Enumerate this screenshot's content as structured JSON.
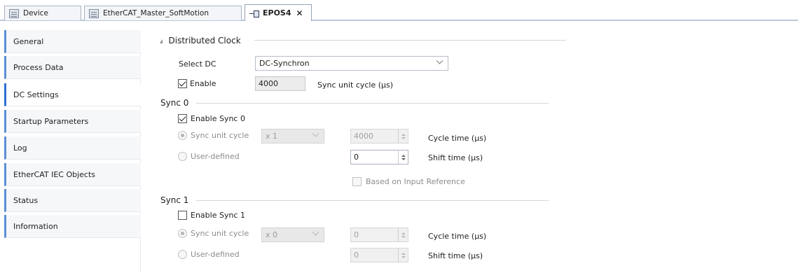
{
  "tabs": [
    {
      "label": "Device",
      "icon": "device-icon"
    },
    {
      "label": "EtherCAT_Master_SoftMotion",
      "icon": "device-icon"
    },
    {
      "label": "EPOS4",
      "icon": "drive-icon",
      "close": "✕"
    }
  ],
  "nav": {
    "items": [
      {
        "label": "General"
      },
      {
        "label": "Process Data"
      },
      {
        "label": "DC Settings"
      },
      {
        "label": "Startup Parameters"
      },
      {
        "label": "Log"
      },
      {
        "label": "EtherCAT IEC Objects"
      },
      {
        "label": "Status"
      },
      {
        "label": "Information"
      }
    ],
    "selected": "DC Settings"
  },
  "dc": {
    "section_title": "Distributed Clock",
    "select_dc_label": "Select DC",
    "select_dc_value": "DC-Synchron",
    "enable_label": "Enable",
    "enable_checked": true,
    "cycle_value": "4000",
    "cycle_unit_label": "Sync unit cycle (µs)"
  },
  "sync0": {
    "title": "Sync 0",
    "enable_label": "Enable Sync 0",
    "enabled": true,
    "sync_unit_cycle_label": "Sync unit cycle",
    "multiplier": "x 1",
    "cycle_time_value": "4000",
    "cycle_time_label": "Cycle time (µs)",
    "user_defined_label": "User-defined",
    "shift_time_value": "0",
    "shift_time_label": "Shift time (µs)",
    "input_ref_label": "Based on Input Reference"
  },
  "sync1": {
    "title": "Sync 1",
    "enable_label": "Enable Sync 1",
    "enabled": false,
    "sync_unit_cycle_label": "Sync unit cycle",
    "multiplier": "x 0",
    "cycle_time_value": "0",
    "cycle_time_label": "Cycle time (µs)",
    "user_defined_label": "User-defined",
    "shift_time_value": "0",
    "shift_time_label": "Shift time (µs)"
  }
}
